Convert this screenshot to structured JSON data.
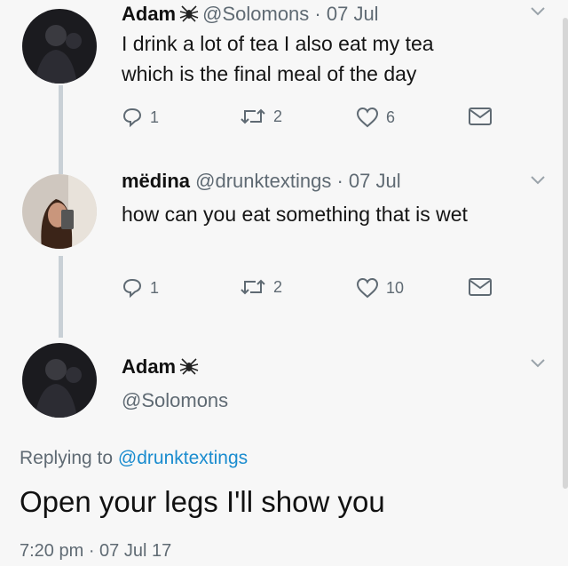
{
  "tweets": [
    {
      "name": "Adam",
      "handle": "@Solomons",
      "date": "· 07 Jul",
      "lines": [
        "I drink a lot of tea I also eat my tea",
        "which is the final meal of the day"
      ],
      "replies": "1",
      "retweets": "2",
      "likes": "6"
    },
    {
      "name": "mëdina",
      "handle": "@drunktextings",
      "date": "· 07 Jul",
      "lines": [
        "how can you eat something that is wet"
      ],
      "replies": "1",
      "retweets": "2",
      "likes": "10"
    }
  ],
  "main_tweet": {
    "name": "Adam",
    "handle": "@Solomons",
    "replying_prefix": "Replying to ",
    "replying_handle": "@drunktextings",
    "text": "Open your legs I'll show you",
    "timestamp": "7:20 pm · 07 Jul 17"
  },
  "colors": {
    "background": "#f7f7f7",
    "secondary_text": "#5f6a73",
    "link": "#1a8ccf",
    "thread_line": "#c9d0d6"
  },
  "icons": [
    "reply-icon",
    "retweet-icon",
    "like-icon",
    "message-icon",
    "chevron-down-icon",
    "spider-emoji-icon"
  ]
}
